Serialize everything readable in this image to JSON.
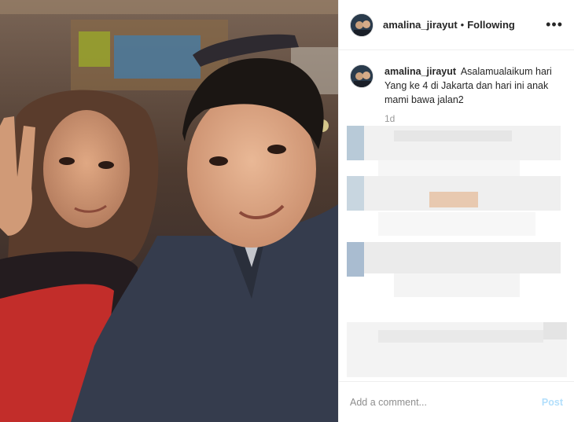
{
  "post": {
    "header": {
      "username": "amalina_jirayut",
      "separator": "•",
      "follow_status": "Following",
      "more_icon": "more-horizontal-icon",
      "more_label": "•••"
    },
    "caption": {
      "username": "amalina_jirayut",
      "text": "Asalamualaikum hari Yang ke 4 di Jakarta dan hari ini anak mami bawa jalan2",
      "time": "1d"
    },
    "add_comment": {
      "placeholder": "Add a comment...",
      "post_label": "Post"
    },
    "colors": {
      "post_disabled": "#b2dffc",
      "text": "#262626",
      "muted": "#999999"
    }
  }
}
